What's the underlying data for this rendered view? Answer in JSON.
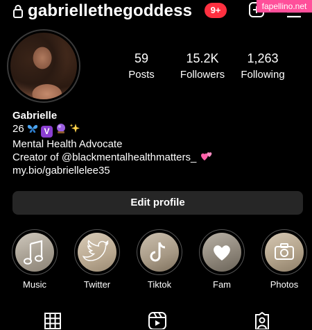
{
  "header": {
    "username": "gabriellethegoddess",
    "notification_count": "9+",
    "watermark": "fapellino.net"
  },
  "profile": {
    "stats": [
      {
        "value": "59",
        "label": "Posts"
      },
      {
        "value": "15.2K",
        "label": "Followers"
      },
      {
        "value": "1,263",
        "label": "Following"
      }
    ],
    "name": "Gabrielle",
    "bio_line1_text": "26",
    "bio_line1_emoji_letter": "V",
    "bio_line2": "Mental Health Advocate",
    "bio_line3": "Creator of @blackmentalhealthmatters_",
    "bio_link": "my.bio/gabriellelee35"
  },
  "actions": {
    "edit_profile_label": "Edit profile"
  },
  "highlights": [
    {
      "label": "Music",
      "icon": "music-note-icon"
    },
    {
      "label": "Twitter",
      "icon": "twitter-bird-icon"
    },
    {
      "label": "Tiktok",
      "icon": "tiktok-icon"
    },
    {
      "label": "Fam",
      "icon": "heart-icon"
    },
    {
      "label": "Photos",
      "icon": "camera-icon"
    }
  ],
  "tabs": [
    {
      "icon": "grid-icon"
    },
    {
      "icon": "reels-icon"
    },
    {
      "icon": "tagged-icon"
    }
  ],
  "colors": {
    "background": "#000000",
    "badge": "#ff3040",
    "button": "#262626",
    "watermark": "#ff4f9a"
  }
}
